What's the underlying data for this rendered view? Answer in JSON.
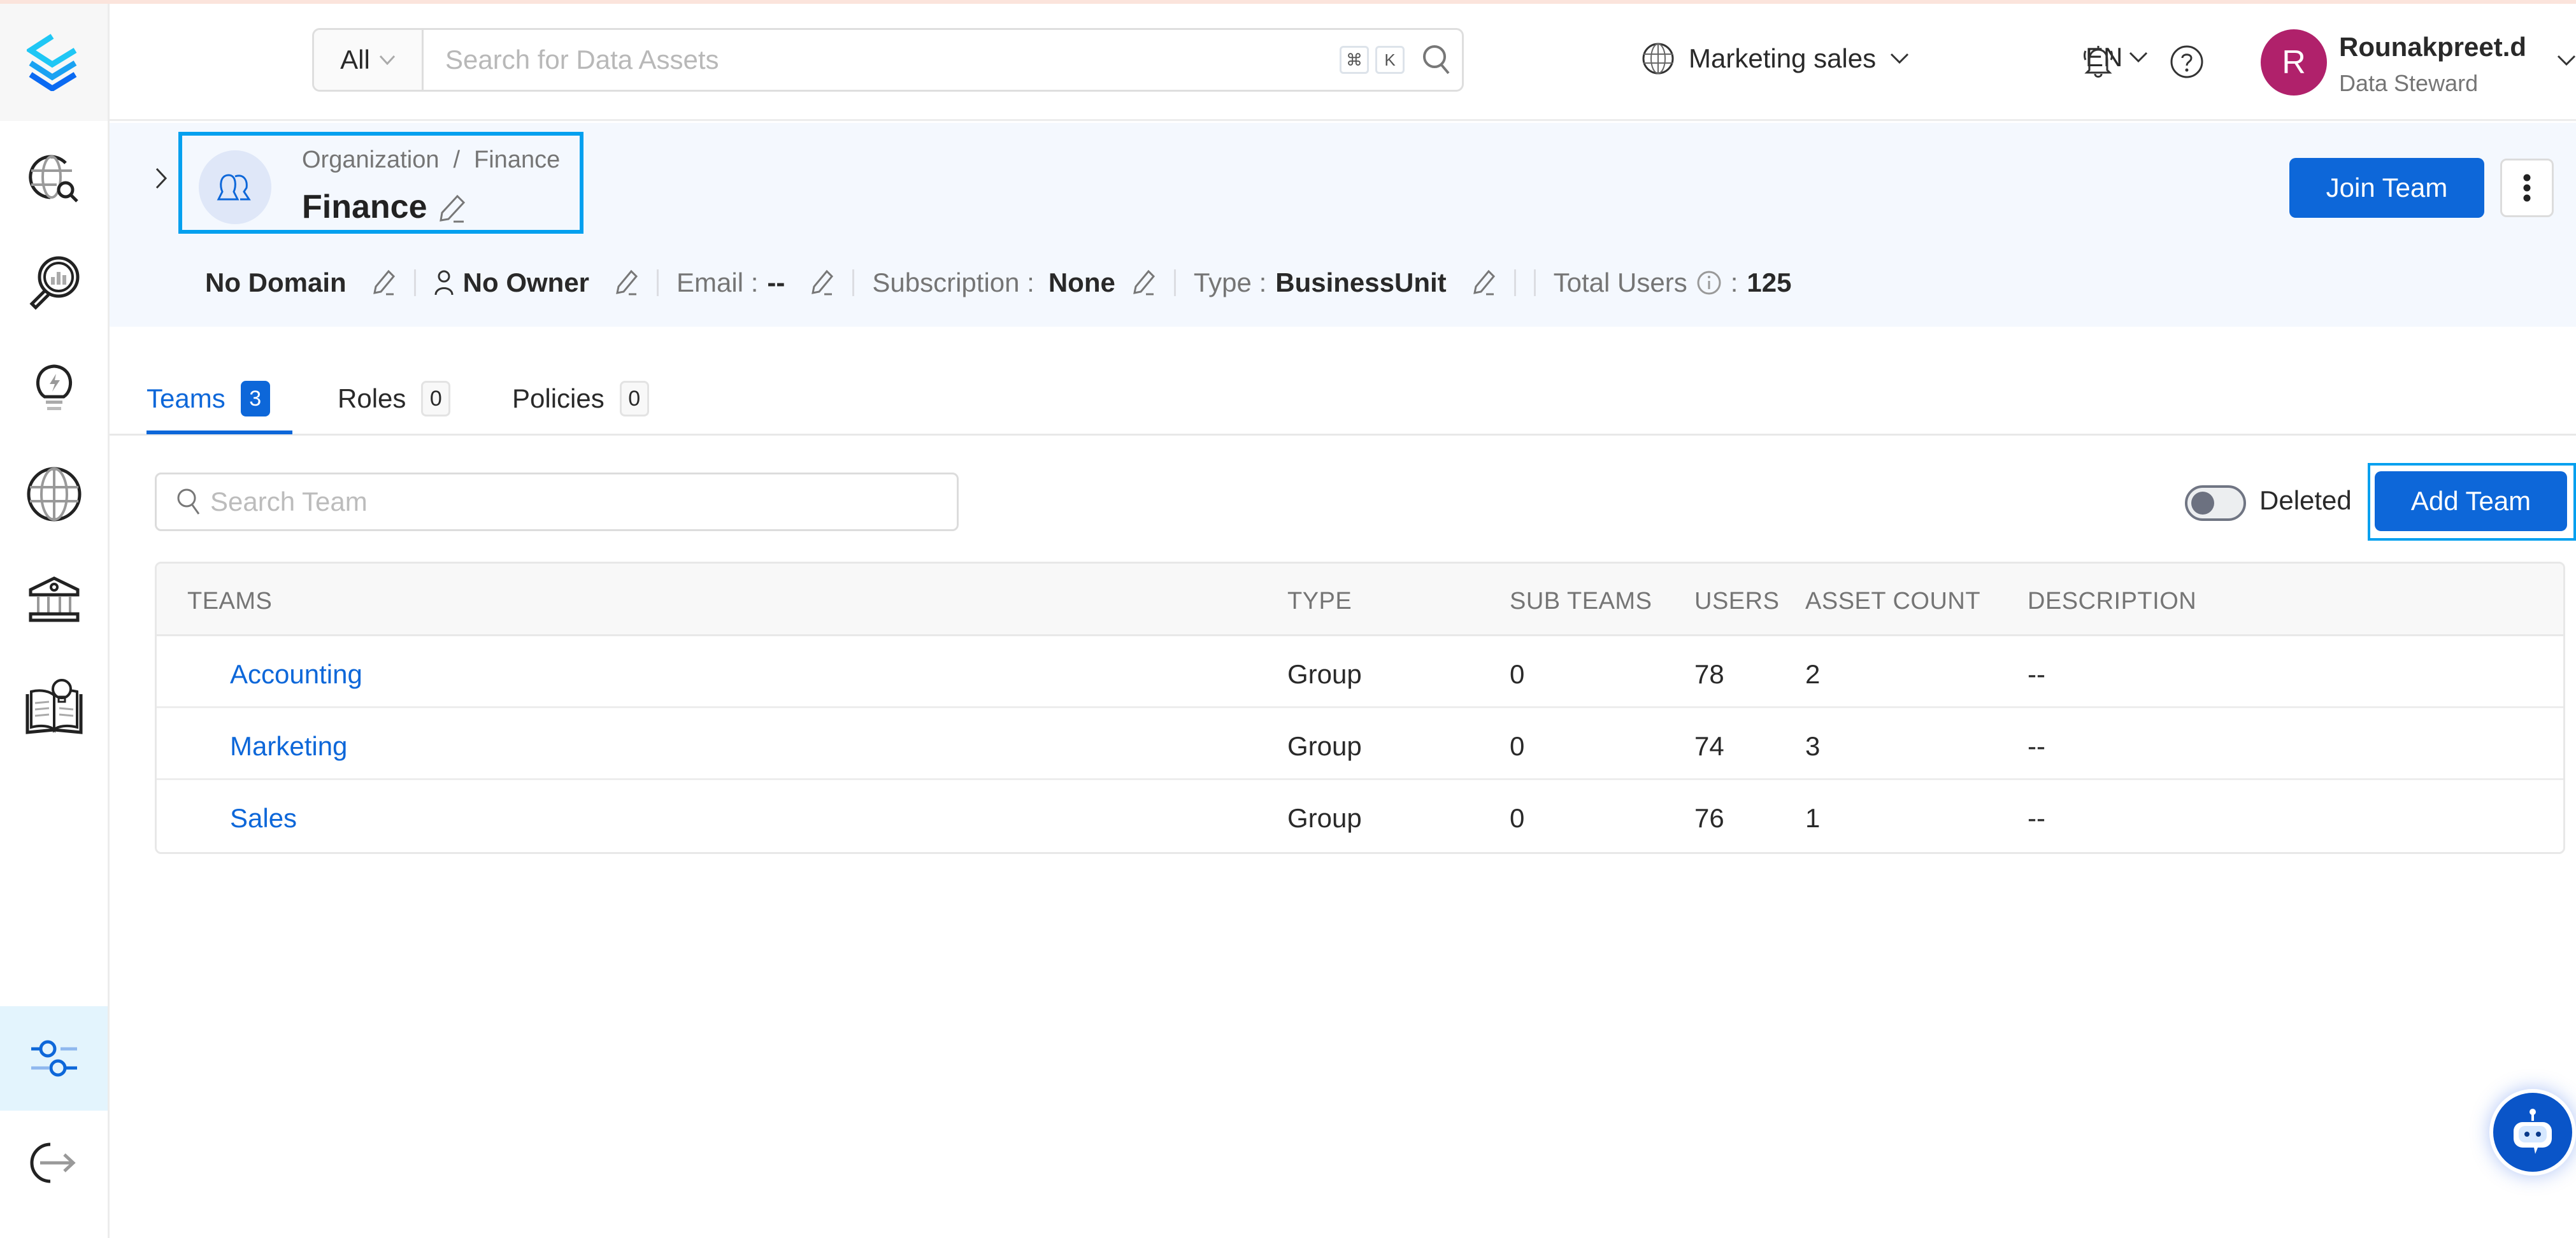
{
  "app": {
    "logo": "layers-logo-icon"
  },
  "sidebar": {
    "items": [
      {
        "name": "explore",
        "icon": "globe-search-icon"
      },
      {
        "name": "data-quality",
        "icon": "magnifier-chart-icon"
      },
      {
        "name": "insights",
        "icon": "lightbulb-icon"
      },
      {
        "name": "domains",
        "icon": "globe-icon"
      },
      {
        "name": "governance",
        "icon": "bank-building-icon"
      },
      {
        "name": "knowledge",
        "icon": "book-lightbulb-icon"
      },
      {
        "name": "settings",
        "icon": "sliders-icon",
        "active": true
      },
      {
        "name": "logout",
        "icon": "logout-icon"
      }
    ]
  },
  "header": {
    "search_scope": "All",
    "search_placeholder": "Search for Data Assets",
    "search_value": "",
    "kbd_cmd": "⌘",
    "kbd_k": "K",
    "domain_selector": "Marketing sales",
    "language": "EN",
    "user": {
      "initial": "R",
      "name": "Rounakpreet.d",
      "role": "Data Steward",
      "avatar_color": "#b0216b"
    }
  },
  "entity": {
    "breadcrumb": [
      "Organization",
      "Finance"
    ],
    "breadcrumb_sep": "/",
    "title": "Finance",
    "join_button": "Join Team",
    "meta": {
      "domain": "No Domain",
      "owner": "No Owner",
      "email_label": "Email :",
      "email_value": "--",
      "subscription_label": "Subscription :",
      "subscription_value": "None",
      "type_label": "Type :",
      "type_value": "BusinessUnit",
      "total_users_label": "Total Users",
      "total_users_sep": ":",
      "total_users_value": "125"
    }
  },
  "tabs": [
    {
      "label": "Teams",
      "count": "3",
      "active": true
    },
    {
      "label": "Roles",
      "count": "0"
    },
    {
      "label": "Policies",
      "count": "0"
    }
  ],
  "toolbar": {
    "search_placeholder": "Search Team",
    "search_value": "",
    "deleted_label": "Deleted",
    "deleted_toggle_on": false,
    "add_button": "Add Team"
  },
  "table": {
    "columns": [
      "TEAMS",
      "TYPE",
      "SUB TEAMS",
      "USERS",
      "ASSET COUNT",
      "DESCRIPTION"
    ],
    "rows": [
      {
        "team": "Accounting",
        "type": "Group",
        "sub_teams": "0",
        "users": "78",
        "asset_count": "2",
        "description": "--"
      },
      {
        "team": "Marketing",
        "type": "Group",
        "sub_teams": "0",
        "users": "74",
        "asset_count": "3",
        "description": "--"
      },
      {
        "team": "Sales",
        "type": "Group",
        "sub_teams": "0",
        "users": "76",
        "asset_count": "1",
        "description": "--"
      }
    ]
  },
  "colors": {
    "primary": "#0d67d9",
    "focus_outline": "#03a0ef",
    "header_band": "#f4f8fe",
    "active_nav": "#e3f4fd"
  },
  "chatbot": {
    "icon": "robot-chat-icon"
  }
}
